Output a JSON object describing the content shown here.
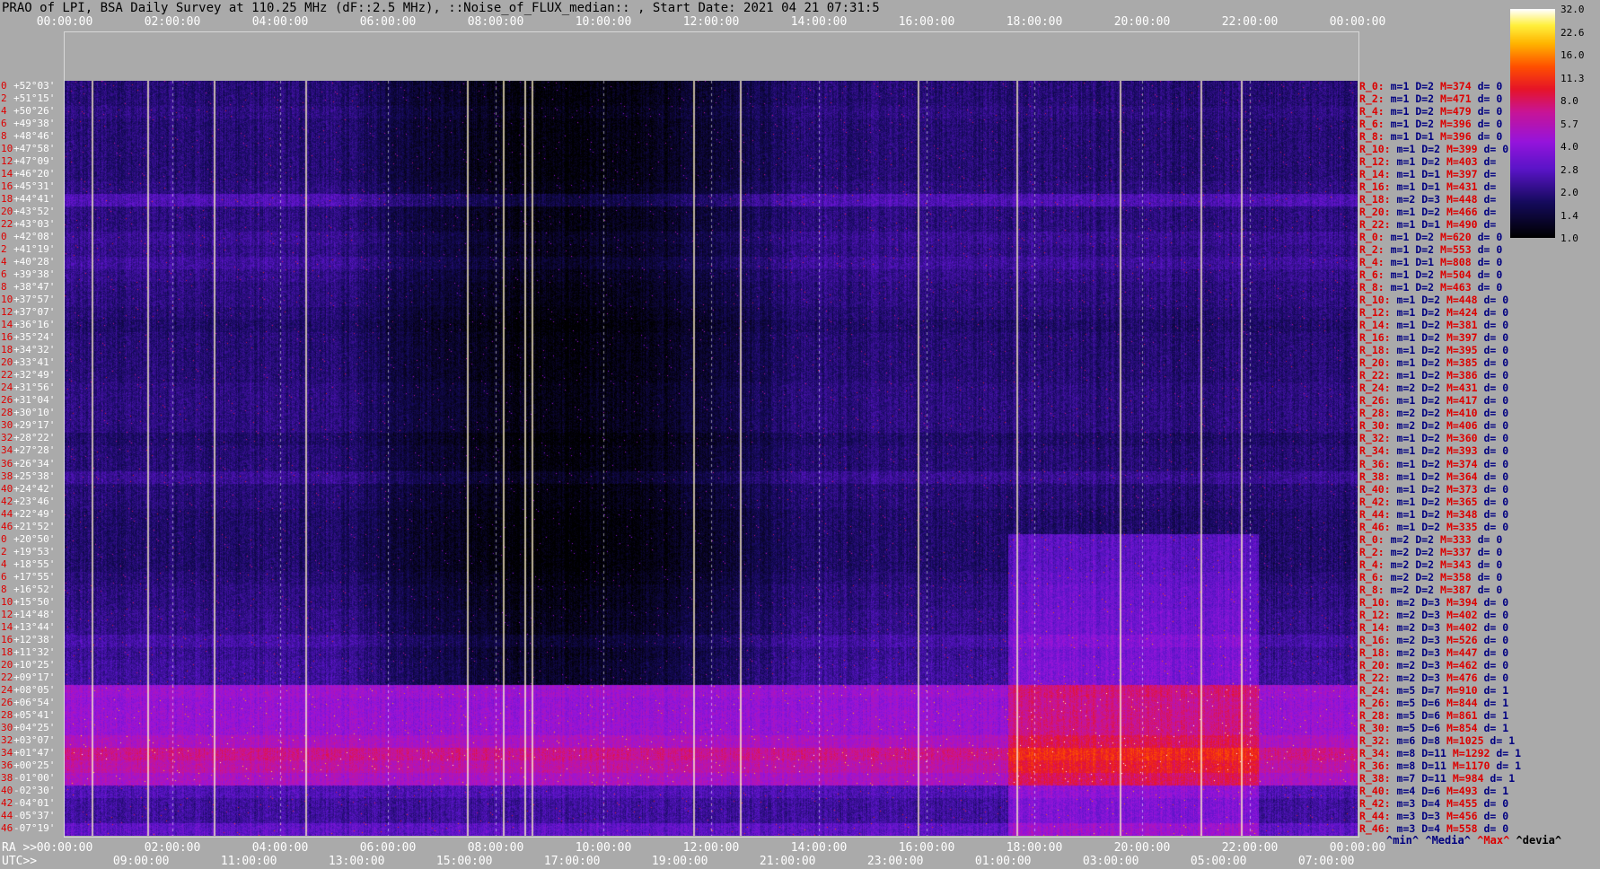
{
  "title": "PRAO of LPI, BSA Daily Survey at 110.25 MHz (dF::2.5 MHz), ::Noise_of_FLUX_median:: , Start Date: 2021 04 21 07:31:5",
  "chart_data": {
    "type": "heatmap",
    "title": "PRAO of LPI, BSA Daily Survey at 110.25 MHz (dF::2.5 MHz), ::Noise_of_FLUX_median:: , Start Date: 2021 04 21 07:31:5",
    "x_top_ticks": [
      "00:00:00",
      "02:00:00",
      "04:00:00",
      "06:00:00",
      "08:00:00",
      "10:00:00",
      "12:00:00",
      "14:00:00",
      "16:00:00",
      "18:00:00",
      "20:00:00",
      "22:00:00",
      "00:00:00"
    ],
    "ra_ticks": [
      "00:00:00",
      "02:00:00",
      "04:00:00",
      "06:00:00",
      "08:00:00",
      "10:00:00",
      "12:00:00",
      "14:00:00",
      "16:00:00",
      "18:00:00",
      "20:00:00",
      "22:00:00",
      "00:00:00"
    ],
    "utc_ticks": [
      "09:00:00",
      "11:00:00",
      "13:00:00",
      "15:00:00",
      "17:00:00",
      "19:00:00",
      "21:00:00",
      "23:00:00",
      "01:00:00",
      "03:00:00",
      "05:00:00",
      "07:00:00"
    ],
    "ra_prefix": "RA >>",
    "utc_prefix": "UTC>>",
    "colorbar_ticks": [
      "32.0",
      "22.6",
      "16.0",
      "11.3",
      "8.0",
      "5.7",
      "4.0",
      "2.8",
      "2.0",
      "1.4",
      "1.0"
    ],
    "colorbar_range": [
      1.0,
      32.0
    ],
    "colorbar_scale": "log",
    "colormap": "gnuplot-like: black-navy-purple-magenta-red-orange-yellow-white",
    "declinations": [
      "+52°03'",
      "+51°15'",
      "+50°26'",
      "+49°38'",
      "+48°46'",
      "+47°58'",
      "+47°09'",
      "+46°20'",
      "+45°31'",
      "+44°41'",
      "+43°52'",
      "+43°03'",
      "+42°08'",
      "+41°19'",
      "+40°28'",
      "+39°38'",
      "+38°47'",
      "+37°57'",
      "+37°07'",
      "+36°16'",
      "+35°24'",
      "+34°32'",
      "+33°41'",
      "+32°49'",
      "+31°56'",
      "+31°04'",
      "+30°10'",
      "+29°17'",
      "+28°22'",
      "+27°28'",
      "+26°34'",
      "+25°38'",
      "+24°42'",
      "+23°46'",
      "+22°49'",
      "+21°52'",
      "+20°50'",
      "+19°53'",
      "+18°55'",
      "+17°55'",
      "+16°52'",
      "+15°50'",
      "+14°48'",
      "+13°44'",
      "+12°38'",
      "+11°32'",
      "+10°25'",
      "+09°17'",
      "+08°05'",
      "+06°54'",
      "+05°41'",
      "+04°25'",
      "+03°07'",
      "+01°47'",
      "+00°25'",
      "-01°00'",
      "-02°30'",
      "-04°01'",
      "-05°37'",
      "-07°19'"
    ],
    "declination_index_labels": [
      "0",
      "2",
      "4",
      "6",
      "8",
      "10",
      "12",
      "14",
      "16",
      "18",
      "20",
      "22",
      "0",
      "2",
      "4",
      "6",
      "8",
      "10",
      "12",
      "14",
      "16",
      "18",
      "20",
      "22",
      "24",
      "26",
      "28",
      "30",
      "32",
      "34",
      "36",
      "38",
      "40",
      "42",
      "44",
      "46",
      "0",
      "2",
      "4",
      "6",
      "8",
      "10",
      "12",
      "14",
      "16",
      "18",
      "20",
      "22",
      "24",
      "26",
      "28",
      "30",
      "32",
      "34",
      "36",
      "38",
      "40",
      "42",
      "44",
      "46"
    ],
    "beam_stats": [
      {
        "r": "R_0:",
        "m": "m=1",
        "d": "D=2",
        "M": "M=374",
        "dev": "d= 0"
      },
      {
        "r": "R_2:",
        "m": "m=1",
        "d": "D=2",
        "M": "M=471",
        "dev": "d= 0"
      },
      {
        "r": "R_4:",
        "m": "m=1",
        "d": "D=2",
        "M": "M=479",
        "dev": "d= 0"
      },
      {
        "r": "R_6:",
        "m": "m=1",
        "d": "D=2",
        "M": "M=396",
        "dev": "d= 0"
      },
      {
        "r": "R_8:",
        "m": "m=1",
        "d": "D=1",
        "M": "M=396",
        "dev": "d= 0"
      },
      {
        "r": "R_10:",
        "m": "m=1",
        "d": "D=2",
        "M": "M=399",
        "dev": "d= 0"
      },
      {
        "r": "R_12:",
        "m": "m=1",
        "d": "D=2",
        "M": "M=403",
        "dev": "d="
      },
      {
        "r": "R_14:",
        "m": "m=1",
        "d": "D=1",
        "M": "M=397",
        "dev": "d="
      },
      {
        "r": "R_16:",
        "m": "m=1",
        "d": "D=1",
        "M": "M=431",
        "dev": "d="
      },
      {
        "r": "R_18:",
        "m": "m=2",
        "d": "D=3",
        "M": "M=448",
        "dev": "d="
      },
      {
        "r": "R_20:",
        "m": "m=1",
        "d": "D=2",
        "M": "M=466",
        "dev": "d="
      },
      {
        "r": "R_22:",
        "m": "m=1",
        "d": "D=1",
        "M": "M=490",
        "dev": "d="
      },
      {
        "r": "R_0:",
        "m": "m=1",
        "d": "D=2",
        "M": "M=620",
        "dev": "d= 0"
      },
      {
        "r": "R_2:",
        "m": "m=1",
        "d": "D=2",
        "M": "M=553",
        "dev": "d= 0"
      },
      {
        "r": "R_4:",
        "m": "m=1",
        "d": "D=1",
        "M": "M=808",
        "dev": "d= 0"
      },
      {
        "r": "R_6:",
        "m": "m=1",
        "d": "D=2",
        "M": "M=504",
        "dev": "d= 0"
      },
      {
        "r": "R_8:",
        "m": "m=1",
        "d": "D=2",
        "M": "M=463",
        "dev": "d= 0"
      },
      {
        "r": "R_10:",
        "m": "m=1",
        "d": "D=2",
        "M": "M=448",
        "dev": "d= 0"
      },
      {
        "r": "R_12:",
        "m": "m=1",
        "d": "D=2",
        "M": "M=424",
        "dev": "d= 0"
      },
      {
        "r": "R_14:",
        "m": "m=1",
        "d": "D=2",
        "M": "M=381",
        "dev": "d= 0"
      },
      {
        "r": "R_16:",
        "m": "m=1",
        "d": "D=2",
        "M": "M=397",
        "dev": "d= 0"
      },
      {
        "r": "R_18:",
        "m": "m=1",
        "d": "D=2",
        "M": "M=395",
        "dev": "d= 0"
      },
      {
        "r": "R_20:",
        "m": "m=1",
        "d": "D=2",
        "M": "M=385",
        "dev": "d= 0"
      },
      {
        "r": "R_22:",
        "m": "m=1",
        "d": "D=2",
        "M": "M=386",
        "dev": "d= 0"
      },
      {
        "r": "R_24:",
        "m": "m=2",
        "d": "D=2",
        "M": "M=431",
        "dev": "d= 0"
      },
      {
        "r": "R_26:",
        "m": "m=1",
        "d": "D=2",
        "M": "M=417",
        "dev": "d= 0"
      },
      {
        "r": "R_28:",
        "m": "m=2",
        "d": "D=2",
        "M": "M=410",
        "dev": "d= 0"
      },
      {
        "r": "R_30:",
        "m": "m=2",
        "d": "D=2",
        "M": "M=406",
        "dev": "d= 0"
      },
      {
        "r": "R_32:",
        "m": "m=1",
        "d": "D=2",
        "M": "M=360",
        "dev": "d= 0"
      },
      {
        "r": "R_34:",
        "m": "m=1",
        "d": "D=2",
        "M": "M=393",
        "dev": "d= 0"
      },
      {
        "r": "R_36:",
        "m": "m=1",
        "d": "D=2",
        "M": "M=374",
        "dev": "d= 0"
      },
      {
        "r": "R_38:",
        "m": "m=1",
        "d": "D=2",
        "M": "M=364",
        "dev": "d= 0"
      },
      {
        "r": "R_40:",
        "m": "m=1",
        "d": "D=2",
        "M": "M=373",
        "dev": "d= 0"
      },
      {
        "r": "R_42:",
        "m": "m=1",
        "d": "D=2",
        "M": "M=365",
        "dev": "d= 0"
      },
      {
        "r": "R_44:",
        "m": "m=1",
        "d": "D=2",
        "M": "M=348",
        "dev": "d= 0"
      },
      {
        "r": "R_46:",
        "m": "m=1",
        "d": "D=2",
        "M": "M=335",
        "dev": "d= 0"
      },
      {
        "r": "R_0:",
        "m": "m=2",
        "d": "D=2",
        "M": "M=333",
        "dev": "d= 0"
      },
      {
        "r": "R_2:",
        "m": "m=2",
        "d": "D=2",
        "M": "M=337",
        "dev": "d= 0"
      },
      {
        "r": "R_4:",
        "m": "m=2",
        "d": "D=2",
        "M": "M=343",
        "dev": "d= 0"
      },
      {
        "r": "R_6:",
        "m": "m=2",
        "d": "D=2",
        "M": "M=358",
        "dev": "d= 0"
      },
      {
        "r": "R_8:",
        "m": "m=2",
        "d": "D=2",
        "M": "M=387",
        "dev": "d= 0"
      },
      {
        "r": "R_10:",
        "m": "m=2",
        "d": "D=3",
        "M": "M=394",
        "dev": "d= 0"
      },
      {
        "r": "R_12:",
        "m": "m=2",
        "d": "D=3",
        "M": "M=402",
        "dev": "d= 0"
      },
      {
        "r": "R_14:",
        "m": "m=2",
        "d": "D=3",
        "M": "M=402",
        "dev": "d= 0"
      },
      {
        "r": "R_16:",
        "m": "m=2",
        "d": "D=3",
        "M": "M=526",
        "dev": "d= 0"
      },
      {
        "r": "R_18:",
        "m": "m=2",
        "d": "D=3",
        "M": "M=447",
        "dev": "d= 0"
      },
      {
        "r": "R_20:",
        "m": "m=2",
        "d": "D=3",
        "M": "M=462",
        "dev": "d= 0"
      },
      {
        "r": "R_22:",
        "m": "m=2",
        "d": "D=3",
        "M": "M=476",
        "dev": "d= 0"
      },
      {
        "r": "R_24:",
        "m": "m=5",
        "d": "D=7",
        "M": "M=910",
        "dev": "d= 1"
      },
      {
        "r": "R_26:",
        "m": "m=5",
        "d": "D=6",
        "M": "M=844",
        "dev": "d= 1"
      },
      {
        "r": "R_28:",
        "m": "m=5",
        "d": "D=6",
        "M": "M=861",
        "dev": "d= 1"
      },
      {
        "r": "R_30:",
        "m": "m=5",
        "d": "D=6",
        "M": "M=854",
        "dev": "d= 1"
      },
      {
        "r": "R_32:",
        "m": "m=6",
        "d": "D=8",
        "M": "M=1025",
        "dev": "d= 1"
      },
      {
        "r": "R_34:",
        "m": "m=8",
        "d": "D=11",
        "M": "M=1292",
        "dev": "d= 1"
      },
      {
        "r": "R_36:",
        "m": "m=8",
        "d": "D=11",
        "M": "M=1170",
        "dev": "d= 1"
      },
      {
        "r": "R_38:",
        "m": "m=7",
        "d": "D=11",
        "M": "M=984",
        "dev": "d= 1"
      },
      {
        "r": "R_40:",
        "m": "m=4",
        "d": "D=6",
        "M": "M=493",
        "dev": "d= 1"
      },
      {
        "r": "R_42:",
        "m": "m=3",
        "d": "D=4",
        "M": "M=455",
        "dev": "d= 0"
      },
      {
        "r": "R_44:",
        "m": "m=3",
        "d": "D=3",
        "M": "M=456",
        "dev": "d= 0"
      },
      {
        "r": "R_46:",
        "m": "m=3",
        "d": "D=4",
        "M": "M=558",
        "dev": "d= 0"
      }
    ],
    "legend": {
      "min": "^min^",
      "median": "^Media^",
      "max": "^Max^",
      "devia": "^devia^"
    },
    "row_median_levels": [
      1.9,
      1.9,
      2.0,
      1.9,
      1.9,
      1.9,
      1.9,
      1.9,
      2.0,
      2.6,
      2.0,
      2.0,
      2.2,
      2.1,
      2.3,
      2.1,
      2.0,
      2.0,
      1.9,
      1.8,
      1.9,
      1.9,
      1.9,
      1.9,
      2.0,
      2.0,
      2.0,
      2.0,
      1.8,
      1.9,
      1.9,
      2.2,
      1.9,
      1.9,
      1.8,
      1.8,
      1.8,
      1.8,
      1.8,
      1.9,
      2.0,
      2.0,
      2.1,
      2.1,
      2.4,
      2.2,
      2.3,
      2.3,
      4.6,
      4.3,
      4.4,
      4.4,
      5.2,
      6.8,
      6.0,
      5.1,
      2.6,
      2.3,
      2.3,
      2.9
    ]
  }
}
